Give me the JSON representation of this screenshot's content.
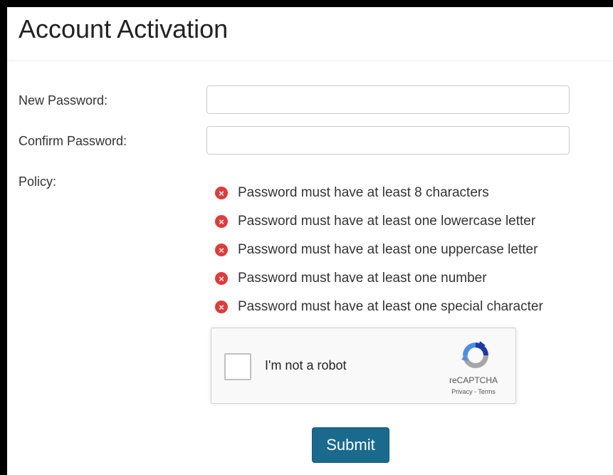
{
  "page": {
    "title": "Account Activation"
  },
  "form": {
    "new_password_label": "New Password:",
    "new_password_value": "",
    "confirm_password_label": "Confirm Password:",
    "confirm_password_value": "",
    "policy_label": "Policy:"
  },
  "policy": {
    "items": [
      {
        "text": "Password must have at least 8 characters",
        "status": "failed",
        "icon": "x-circle-icon"
      },
      {
        "text": "Password must have at least one lowercase letter",
        "status": "failed",
        "icon": "x-circle-icon"
      },
      {
        "text": "Password must have at least one uppercase letter",
        "status": "failed",
        "icon": "x-circle-icon"
      },
      {
        "text": "Password must have at least one number",
        "status": "failed",
        "icon": "x-circle-icon"
      },
      {
        "text": "Password must have at least one special character",
        "status": "failed",
        "icon": "x-circle-icon"
      }
    ],
    "icon_glyph": "×",
    "fail_color": "#e03b3b"
  },
  "captcha": {
    "label": "I'm not a robot",
    "checked": false,
    "brand": "reCAPTCHA",
    "privacy": "Privacy",
    "separator": " - ",
    "terms": "Terms",
    "logo_icon": "recaptcha-logo-icon"
  },
  "submit": {
    "label": "Submit",
    "color": "#1a6a8d"
  }
}
